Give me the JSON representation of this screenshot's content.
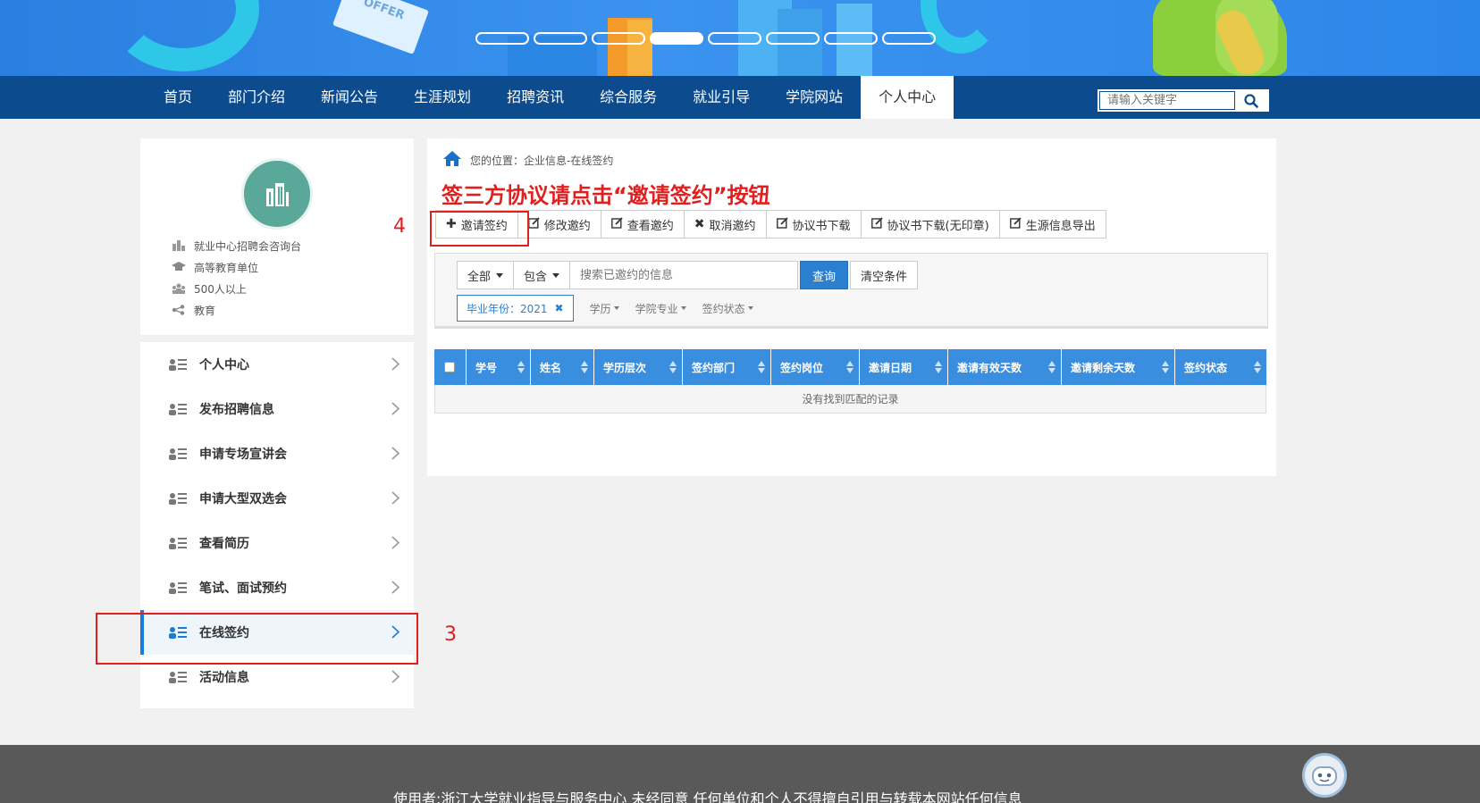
{
  "banner": {
    "card_text": "OFFER",
    "slides": 8,
    "active_slide": 4
  },
  "nav": {
    "items": [
      {
        "label": "首页"
      },
      {
        "label": "部门介绍"
      },
      {
        "label": "新闻公告"
      },
      {
        "label": "生涯规划"
      },
      {
        "label": "招聘资讯"
      },
      {
        "label": "综合服务"
      },
      {
        "label": "就业引导"
      },
      {
        "label": "学院网站"
      },
      {
        "label": "个人中心"
      }
    ],
    "active_label": "个人中心",
    "search_placeholder": "请输入关键字"
  },
  "profile": {
    "info": [
      {
        "icon": "building-icon",
        "text": "就业中心招聘会咨询台"
      },
      {
        "icon": "graduation-cap-icon",
        "text": "高等教育单位"
      },
      {
        "icon": "people-icon",
        "text": "500人以上"
      },
      {
        "icon": "share-icon",
        "text": "教育"
      }
    ]
  },
  "menu": {
    "items": [
      {
        "label": "个人中心"
      },
      {
        "label": "发布招聘信息"
      },
      {
        "label": "申请专场宣讲会"
      },
      {
        "label": "申请大型双选会"
      },
      {
        "label": "查看简历"
      },
      {
        "label": "笔试、面试预约"
      },
      {
        "label": "在线签约"
      },
      {
        "label": "活动信息"
      }
    ],
    "active_label": "在线签约"
  },
  "annotations": {
    "step3": "3",
    "step4": "4"
  },
  "main": {
    "breadcrumb": "您的位置：企业信息-在线签约",
    "notice": "签三方协议请点击“邀请签约”按钮",
    "toolbar": [
      {
        "icon": "plus-icon",
        "label": "邀请签约"
      },
      {
        "icon": "edit-icon",
        "label": "修改邀约"
      },
      {
        "icon": "edit-icon",
        "label": "查看邀约"
      },
      {
        "icon": "times-icon",
        "label": "取消邀约"
      },
      {
        "icon": "edit-icon",
        "label": "协议书下载"
      },
      {
        "icon": "edit-icon",
        "label": "协议书下载(无印章)"
      },
      {
        "icon": "edit-icon",
        "label": "生源信息导出"
      }
    ],
    "filter": {
      "scope": "全部",
      "match": "包含",
      "search_placeholder": "搜索已邀约的信息",
      "query_label": "查询",
      "clear_label": "清空条件",
      "active_tag": "毕业年份：2021",
      "links": [
        "学历",
        "学院专业",
        "签约状态"
      ]
    },
    "table": {
      "columns": [
        "学号",
        "姓名",
        "学历层次",
        "签约部门",
        "签约岗位",
        "邀请日期",
        "邀请有效天数",
        "邀请剩余天数",
        "签约状态"
      ],
      "empty_text": "没有找到匹配的记录"
    }
  },
  "footer": {
    "text": "使用者:浙江大学就业指导与服务中心 未经同意 任何单位和个人不得擅自引用与转载本网站任何信息"
  },
  "colors": {
    "nav_bg": "#0c4b8e",
    "accent": "#2b7fcf",
    "table_header": "#3a8ee0",
    "annotation_red": "#e0201f",
    "avatar_bg": "#5aa89a",
    "footer_bg": "#595959"
  }
}
